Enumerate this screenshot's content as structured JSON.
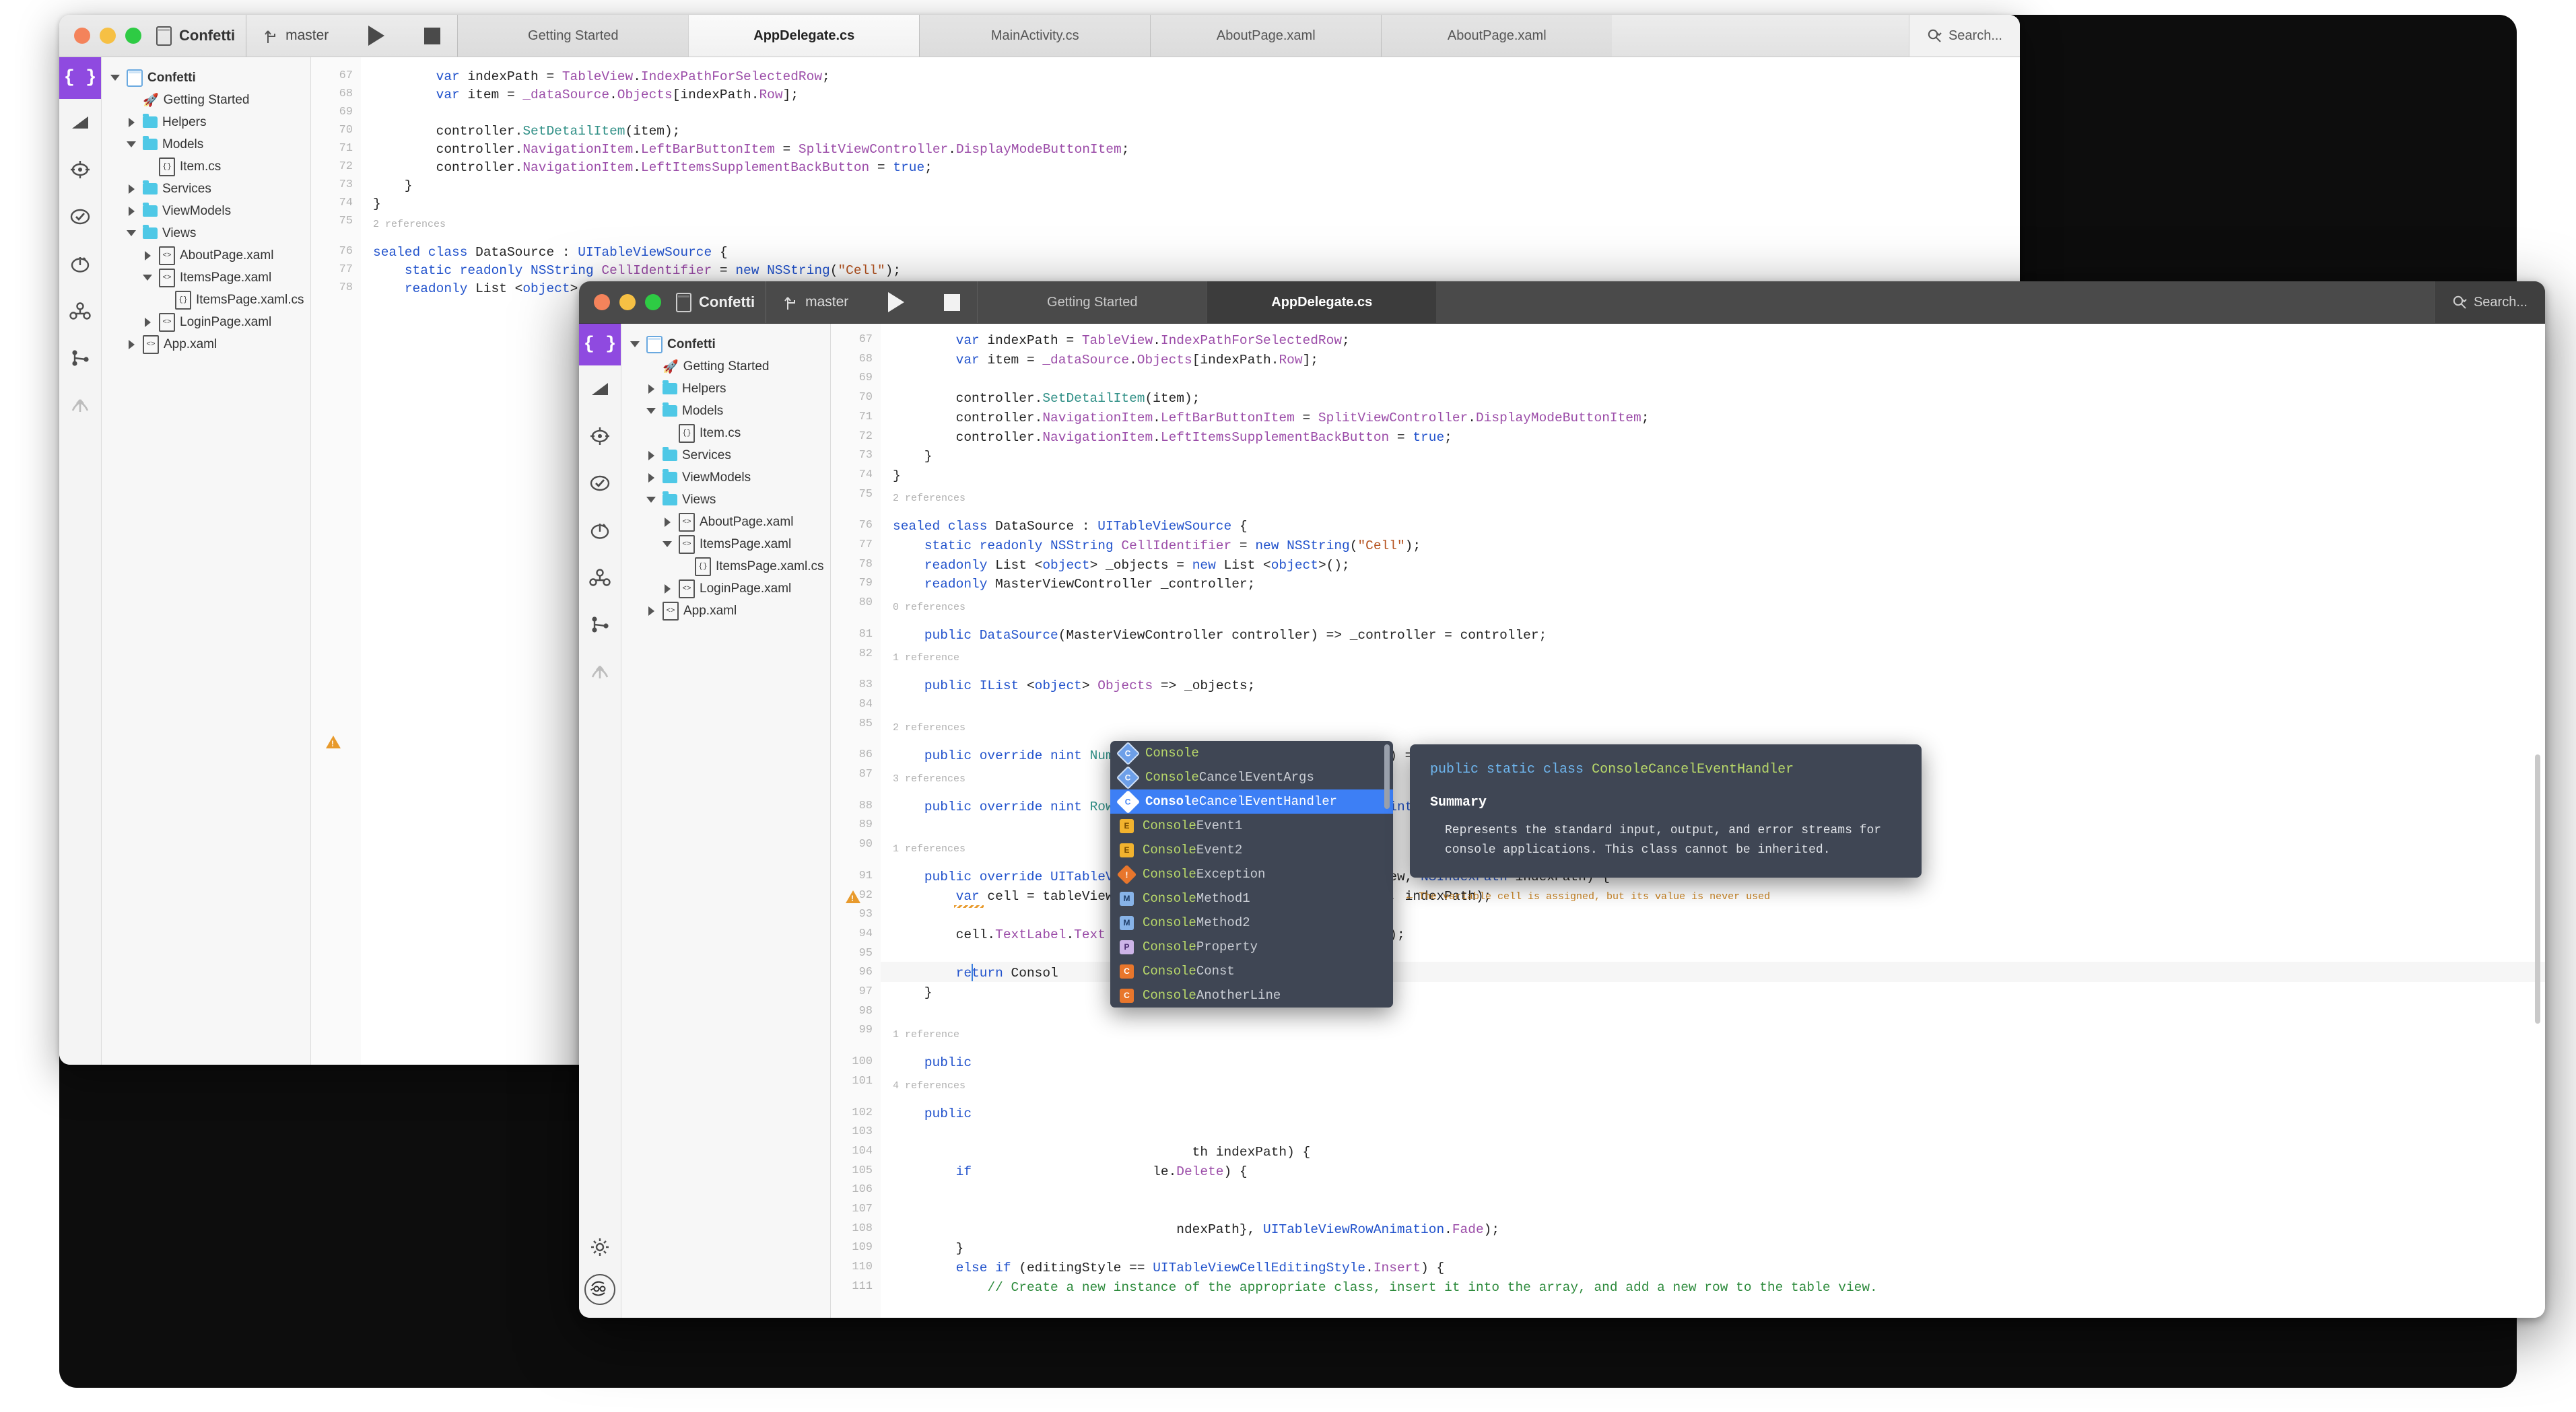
{
  "back_window": {
    "project_name": "Confetti",
    "branch": "master",
    "run_label": "run",
    "stop_label": "stop",
    "tabs": [
      {
        "label": "Getting Started",
        "active": false
      },
      {
        "label": "AppDelegate.cs",
        "active": true
      },
      {
        "label": "MainActivity.cs",
        "active": false
      },
      {
        "label": "AboutPage.xaml",
        "active": false
      },
      {
        "label": "AboutPage.xaml",
        "active": false
      }
    ],
    "search": {
      "placeholder": "Search...",
      "label": "Search..."
    },
    "rail_icons": [
      "braces-icon",
      "ruler-icon",
      "target-icon",
      "check-circle-icon",
      "stopwatch-icon",
      "share-nodes-icon",
      "branch-icon",
      "merge-arrows-icon"
    ],
    "tree": [
      {
        "label": "Confetti",
        "indent": 0,
        "twisty": "down",
        "icon": "project-icon",
        "bold": true
      },
      {
        "label": "Getting Started",
        "indent": 1,
        "twisty": "none",
        "icon": "rocket-icon",
        "bold": false
      },
      {
        "label": "Helpers",
        "indent": 1,
        "twisty": "right",
        "icon": "folder-icon",
        "bold": false
      },
      {
        "label": "Models",
        "indent": 1,
        "twisty": "down",
        "icon": "folder-icon",
        "bold": false
      },
      {
        "label": "Item.cs",
        "indent": 2,
        "twisty": "none",
        "icon": "cs-file-icon",
        "bold": false
      },
      {
        "label": "Services",
        "indent": 1,
        "twisty": "right",
        "icon": "folder-icon",
        "bold": false
      },
      {
        "label": "ViewModels",
        "indent": 1,
        "twisty": "right",
        "icon": "folder-icon",
        "bold": false
      },
      {
        "label": "Views",
        "indent": 1,
        "twisty": "down",
        "icon": "folder-icon",
        "bold": false
      },
      {
        "label": "AboutPage.xaml",
        "indent": 2,
        "twisty": "right",
        "icon": "xaml-file-icon",
        "bold": false
      },
      {
        "label": "ItemsPage.xaml",
        "indent": 2,
        "twisty": "down",
        "icon": "xaml-file-icon",
        "bold": false
      },
      {
        "label": "ItemsPage.xaml.cs",
        "indent": 3,
        "twisty": "none",
        "icon": "cs-file-icon",
        "bold": false
      },
      {
        "label": "LoginPage.xaml",
        "indent": 2,
        "twisty": "right",
        "icon": "xaml-file-icon",
        "bold": false
      },
      {
        "label": "App.xaml",
        "indent": 1,
        "twisty": "right",
        "icon": "xaml-file-icon",
        "bold": false
      }
    ]
  },
  "front_window": {
    "project_name": "Confetti",
    "branch": "master",
    "tabs": [
      {
        "label": "Getting Started",
        "active": false
      },
      {
        "label": "AppDelegate.cs",
        "active": true
      }
    ],
    "search": {
      "placeholder": "Search...",
      "label": "Search..."
    },
    "rail_icons": [
      "braces-icon",
      "ruler-icon",
      "target-icon",
      "check-circle-icon",
      "stopwatch-icon",
      "share-nodes-icon",
      "branch-icon",
      "merge-arrows-icon"
    ],
    "rail_bottom_icons": [
      "gear-icon",
      "account-avatar-icon"
    ],
    "tree": [
      {
        "label": "Confetti",
        "indent": 0,
        "twisty": "down",
        "icon": "project-icon",
        "bold": true
      },
      {
        "label": "Getting Started",
        "indent": 1,
        "twisty": "none",
        "icon": "rocket-icon",
        "bold": false
      },
      {
        "label": "Helpers",
        "indent": 1,
        "twisty": "right",
        "icon": "folder-icon",
        "bold": false
      },
      {
        "label": "Models",
        "indent": 1,
        "twisty": "down",
        "icon": "folder-icon",
        "bold": false
      },
      {
        "label": "Item.cs",
        "indent": 2,
        "twisty": "none",
        "icon": "cs-file-icon",
        "bold": false
      },
      {
        "label": "Services",
        "indent": 1,
        "twisty": "right",
        "icon": "folder-icon",
        "bold": false
      },
      {
        "label": "ViewModels",
        "indent": 1,
        "twisty": "right",
        "icon": "folder-icon",
        "bold": false
      },
      {
        "label": "Views",
        "indent": 1,
        "twisty": "down",
        "icon": "folder-icon",
        "bold": false
      },
      {
        "label": "AboutPage.xaml",
        "indent": 2,
        "twisty": "right",
        "icon": "xaml-file-icon",
        "bold": false
      },
      {
        "label": "ItemsPage.xaml",
        "indent": 2,
        "twisty": "down",
        "icon": "xaml-file-icon",
        "bold": false
      },
      {
        "label": "ItemsPage.xaml.cs",
        "indent": 3,
        "twisty": "none",
        "icon": "cs-file-icon",
        "bold": false
      },
      {
        "label": "LoginPage.xaml",
        "indent": 2,
        "twisty": "right",
        "icon": "xaml-file-icon",
        "bold": false
      },
      {
        "label": "App.xaml",
        "indent": 1,
        "twisty": "right",
        "icon": "xaml-file-icon",
        "bold": false
      }
    ],
    "inline_warning": "← The variable cell is assigned, but its value is never used",
    "typed_text": "Consol"
  },
  "code_lines": [
    {
      "n": "67",
      "html": "        <span class='k'>var</span> indexPath = <span class='t'>TableView</span>.<span class='t'>IndexPathForSelectedRow</span>;"
    },
    {
      "n": "68",
      "html": "        <span class='k'>var</span> item = <span class='t'>_dataSource</span>.<span class='t'>Objects</span>[indexPath.<span class='t'>Row</span>];"
    },
    {
      "n": "69",
      "html": ""
    },
    {
      "n": "70",
      "html": "        controller.<span class='m'>SetDetailItem</span>(item);"
    },
    {
      "n": "71",
      "html": "        controller.<span class='t'>NavigationItem</span>.<span class='t'>LeftBarButtonItem</span> = <span class='t'>SplitViewController</span>.<span class='t'>DisplayModeButtonItem</span>;"
    },
    {
      "n": "72",
      "html": "        controller.<span class='t'>NavigationItem</span>.<span class='t'>LeftItemsSupplementBackButton</span> = <span class='k'>true</span>;"
    },
    {
      "n": "73",
      "html": "    }"
    },
    {
      "n": "74",
      "html": "}"
    },
    {
      "n": "75",
      "html": ""
    },
    {
      "n": "76",
      "html": "<span class='k'>sealed class</span> DataSource : <span class='k'>UITableViewSource</span> {",
      "ref": "2 references"
    },
    {
      "n": "77",
      "html": "    <span class='k'>static readonly</span> <span class='k'>NSString</span> <span class='t'>CellIdentifier</span> = <span class='k'>new</span> <span class='k'>NSString</span>(<span class='s'>\"Cell\"</span>);"
    },
    {
      "n": "78",
      "html": "    <span class='k'>readonly</span> List &lt;<span class='k'>object</span>&gt; _objects = <span class='k'>new</span> List &lt;<span class='k'>object</span>&gt;();"
    },
    {
      "n": "79",
      "html": "    <span class='k'>readonly</span> MasterViewController _controller;"
    },
    {
      "n": "80",
      "html": ""
    },
    {
      "n": "81",
      "html": "    <span class='k'>public</span> <span class='k'>DataSource</span>(MasterViewController controller) =&gt; _controller = controller;",
      "ref": "0 references"
    },
    {
      "n": "82",
      "html": ""
    },
    {
      "n": "83",
      "html": "    <span class='k'>public</span> <span class='k'>IList</span> &lt;<span class='k'>object</span>&gt; <span class='t'>Objects</span> =&gt; _objects;",
      "ref": "1 reference"
    },
    {
      "n": "84",
      "html": ""
    },
    {
      "n": "85",
      "html": ""
    },
    {
      "n": "86",
      "html": "    <span class='k'>public override nint</span> <span class='m'>NumberOfSections</span>(<span class='k'>UITableView</span> tableView) =&gt; <span class='p'>1</span>;",
      "ref": "2 references"
    },
    {
      "n": "87",
      "html": ""
    },
    {
      "n": "88",
      "html": "    <span class='k'>public override nint</span> <span class='m'>RowsInSection</span>(<span class='k'>UITableView</span> tableview, <span class='k'>nint</span> section) =&gt; _objects.<span class='t'>Count</span>;",
      "ref": "3 references"
    },
    {
      "n": "89",
      "html": ""
    },
    {
      "n": "90",
      "html": ""
    },
    {
      "n": "91",
      "html": "    <span class='k'>public override</span> <span class='k'>UITableViewCell</span> <span class='m'>GetCell</span>(<span class='k'>UITableView</span> tableView, <span class='k'>NSIndexPath</span> indexPath) {",
      "ref": "1 references"
    },
    {
      "n": "92",
      "html": "        <span class='k'>var</span> cell = tableView.<span class='m'>DequeueReusableCell</span>(<span class='t'>CellIdentifier</span>, indexPath);",
      "warn": true
    },
    {
      "n": "93",
      "html": ""
    },
    {
      "n": "94",
      "html": "        cell.<span class='t'>TextLabel</span>.<span class='t'>Text</span> = _objects[indexPath.<span class='t'>Row</span>].<span class='m'>ToString</span>();"
    },
    {
      "n": "95",
      "html": ""
    },
    {
      "n": "96",
      "html": "        <span class='k'>return</span> Consol",
      "current": true
    },
    {
      "n": "97",
      "html": "    }"
    },
    {
      "n": "98",
      "html": ""
    },
    {
      "n": "99",
      "html": ""
    },
    {
      "n": "100",
      "html": "    <span class='k'>public</span>",
      "ref": "1 reference"
    },
    {
      "n": "101",
      "html": ""
    },
    {
      "n": "102",
      "html": "    <span class='k'>public</span>",
      "ref": "4 references"
    },
    {
      "n": "103",
      "html": ""
    },
    {
      "n": "104",
      "html": "                                      th indexPath) {"
    },
    {
      "n": "105",
      "html": "        <span class='k'>if</span>                       le.<span class='t'>Delete</span>) {"
    },
    {
      "n": "106",
      "html": ""
    },
    {
      "n": "107",
      "html": ""
    },
    {
      "n": "108",
      "html": "                                    ndexPath}, <span class='k'>UITableViewRowAnimation</span>.<span class='t'>Fade</span>);"
    },
    {
      "n": "109",
      "html": "        }"
    },
    {
      "n": "110",
      "html": "        <span class='k'>else if</span> (editingStyle == <span class='k'>UITableViewCellEditingStyle</span>.<span class='t'>Insert</span>) {"
    },
    {
      "n": "111",
      "html": "            <span class='c'>// Create a new instance of the appropriate class, insert it into the array, and add a new row to the table view.</span>"
    }
  ],
  "autocomplete": {
    "items": [
      {
        "label": "Console",
        "prefix": "Console",
        "icon": "class-icon",
        "icon_kind": "dia-class",
        "glyph": "C",
        "selected": false
      },
      {
        "label": "ConsoleCancelEventArgs",
        "prefix": "Console",
        "icon": "class-icon",
        "icon_kind": "dia-class",
        "glyph": "C",
        "selected": false
      },
      {
        "label": "ConsoleCancelEventHandler",
        "prefix": "Consol",
        "icon": "class-icon",
        "icon_kind": "dia-class-sel",
        "glyph": "C",
        "selected": true
      },
      {
        "label": "ConsoleEvent1",
        "prefix": "Console",
        "icon": "event-icon",
        "icon_kind": "sq-evt",
        "glyph": "E",
        "selected": false
      },
      {
        "label": "ConsoleEvent2",
        "prefix": "Console",
        "icon": "event-icon",
        "icon_kind": "sq-evt",
        "glyph": "E",
        "selected": false
      },
      {
        "label": "ConsoleException",
        "prefix": "Console",
        "icon": "exception-icon",
        "icon_kind": "dia-exc",
        "glyph": "!",
        "selected": false
      },
      {
        "label": "ConsoleMethod1",
        "prefix": "Console",
        "icon": "method-icon",
        "icon_kind": "sq-mth",
        "glyph": "M",
        "selected": false
      },
      {
        "label": "ConsoleMethod2",
        "prefix": "Console",
        "icon": "method-icon",
        "icon_kind": "sq-mth",
        "glyph": "M",
        "selected": false
      },
      {
        "label": "ConsoleProperty",
        "prefix": "Console",
        "icon": "property-icon",
        "icon_kind": "sq-prop",
        "glyph": "P",
        "selected": false
      },
      {
        "label": "ConsoleConst",
        "prefix": "Console",
        "icon": "constant-icon",
        "icon_kind": "sq-const",
        "glyph": "C",
        "selected": false
      },
      {
        "label": "ConsoleAnotherLine",
        "prefix": "Console",
        "icon": "constant-icon",
        "icon_kind": "sq-const",
        "glyph": "C",
        "selected": false
      }
    ]
  },
  "tooltip": {
    "signature_keywords": "public static class",
    "signature_type": "ConsoleCancelEventHandler",
    "heading": "Summary",
    "body": "Represents the standard input, output, and error streams for console applications. This class cannot be inherited."
  },
  "colors": {
    "accent_purple": "#8f4ae0",
    "folder_blue": "#4ec8e6",
    "select_blue": "#3d7ff5",
    "warning_orange": "#e89a2c",
    "popup_bg": "#3f4654"
  }
}
